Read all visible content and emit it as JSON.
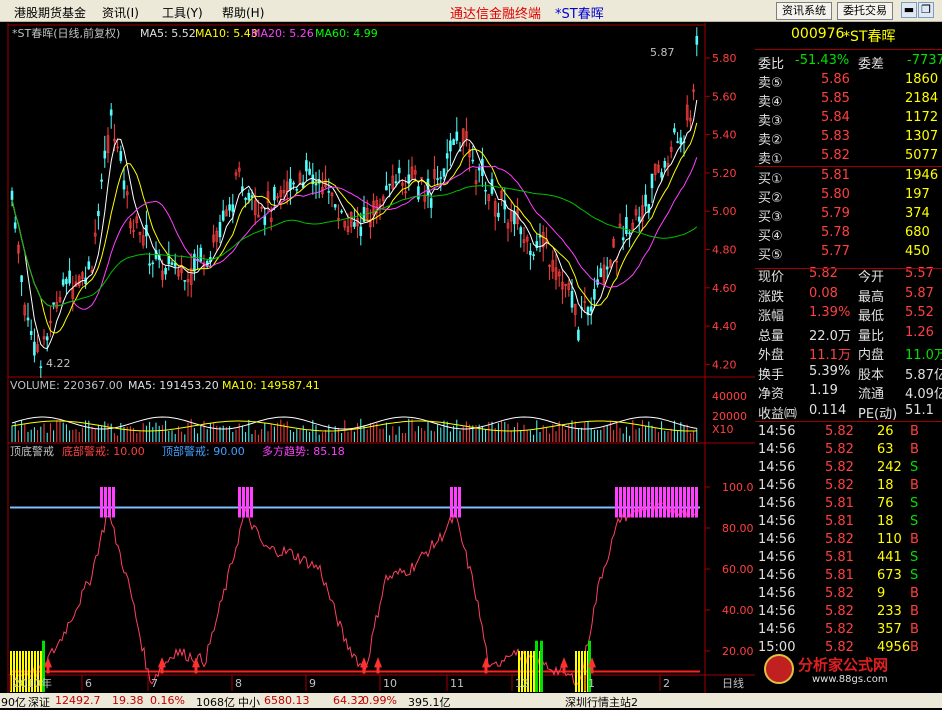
{
  "menu": {
    "items": [
      "港股期货基金",
      "资讯(I)",
      "工具(Y)",
      "帮助(H)"
    ],
    "center": "通达信金融终端",
    "center_stock": "*ST春晖",
    "btn_news": "资讯系统",
    "btn_trade": "委托交易"
  },
  "chart_header": {
    "name": "*ST春晖(日线,前复权)",
    "ma5": "MA5: 5.52",
    "ma10": "MA10: 5.43",
    "ma20": "MA20: 5.26",
    "ma60": "MA60: 4.99",
    "high_mark": "5.87",
    "low_mark": "4.22"
  },
  "price_axis": [
    "5.80",
    "5.60",
    "5.40",
    "5.20",
    "5.00",
    "4.80",
    "4.60",
    "4.40",
    "4.20"
  ],
  "volume_header": {
    "vol": "VOLUME: 220367.00",
    "ma5": "MA5: 191453.20",
    "ma10": "MA10: 149587.41"
  },
  "volume_axis": [
    "40000",
    "20000",
    "X10"
  ],
  "indicator_header": {
    "name": "顶底警戒",
    "bottom": "底部警戒: 10.00",
    "top": "顶部警戒: 90.00",
    "trend": "多方趋势: 85.18"
  },
  "indicator_axis": [
    "100.0",
    "80.00",
    "60.00",
    "40.00",
    "20.00"
  ],
  "x_axis": [
    "2010年",
    "6",
    "7",
    "8",
    "9",
    "10",
    "11",
    "12",
    "1",
    "2",
    "日线"
  ],
  "quote": {
    "code": "000976",
    "name": "*ST春晖",
    "wb_label": "委比",
    "wb": "-51.43%",
    "wc_label": "委差",
    "wc": "-7737",
    "asks": [
      {
        "l": "卖⑤",
        "p": "5.86",
        "v": "1860"
      },
      {
        "l": "卖④",
        "p": "5.85",
        "v": "2184"
      },
      {
        "l": "卖③",
        "p": "5.84",
        "v": "1172"
      },
      {
        "l": "卖②",
        "p": "5.83",
        "v": "1307"
      },
      {
        "l": "卖①",
        "p": "5.82",
        "v": "5077"
      }
    ],
    "bids": [
      {
        "l": "买①",
        "p": "5.81",
        "v": "1946"
      },
      {
        "l": "买②",
        "p": "5.80",
        "v": "197"
      },
      {
        "l": "买③",
        "p": "5.79",
        "v": "374"
      },
      {
        "l": "买④",
        "p": "5.78",
        "v": "680"
      },
      {
        "l": "买⑤",
        "p": "5.77",
        "v": "450"
      }
    ],
    "stats": [
      [
        "现价",
        "5.82",
        "今开",
        "5.57"
      ],
      [
        "涨跌",
        "0.08",
        "最高",
        "5.87"
      ],
      [
        "涨幅",
        "1.39%",
        "最低",
        "5.52"
      ],
      [
        "总量",
        "22.0万",
        "量比",
        "1.26"
      ],
      [
        "外盘",
        "11.1万",
        "内盘",
        "11.0万"
      ],
      [
        "换手",
        "5.39%",
        "股本",
        "5.87亿"
      ],
      [
        "净资",
        "1.19",
        "流通",
        "4.09亿"
      ],
      [
        "收益㈣",
        "0.114",
        "PE(动)",
        "51.1"
      ]
    ],
    "ticks": [
      [
        "14:56",
        "5.82",
        "26",
        "B"
      ],
      [
        "14:56",
        "5.82",
        "63",
        "B"
      ],
      [
        "14:56",
        "5.82",
        "242",
        "S"
      ],
      [
        "14:56",
        "5.82",
        "18",
        "B"
      ],
      [
        "14:56",
        "5.81",
        "76",
        "S"
      ],
      [
        "14:56",
        "5.81",
        "18",
        "S"
      ],
      [
        "14:56",
        "5.82",
        "110",
        "B"
      ],
      [
        "14:56",
        "5.81",
        "441",
        "S"
      ],
      [
        "14:56",
        "5.81",
        "673",
        "S"
      ],
      [
        "14:56",
        "5.82",
        "9",
        "B"
      ],
      [
        "14:56",
        "5.82",
        "233",
        "B"
      ],
      [
        "14:56",
        "5.82",
        "357",
        "B"
      ],
      [
        "15:00",
        "5.82",
        "4956",
        "B"
      ]
    ]
  },
  "status": {
    "s1": "90亿",
    "s2": "深证",
    "s3": "12492.7",
    "s4": "19.38",
    "s5": "0.16%",
    "s6": "1068亿",
    "s7": "中小",
    "s8": "6580.13",
    "s9": "64.32",
    "s10": "0.99%",
    "s11": "395.1亿",
    "s12": "深圳行情主站2"
  },
  "watermark": {
    "t1": "分析家公式网",
    "t2": "www.88gs.com"
  }
}
